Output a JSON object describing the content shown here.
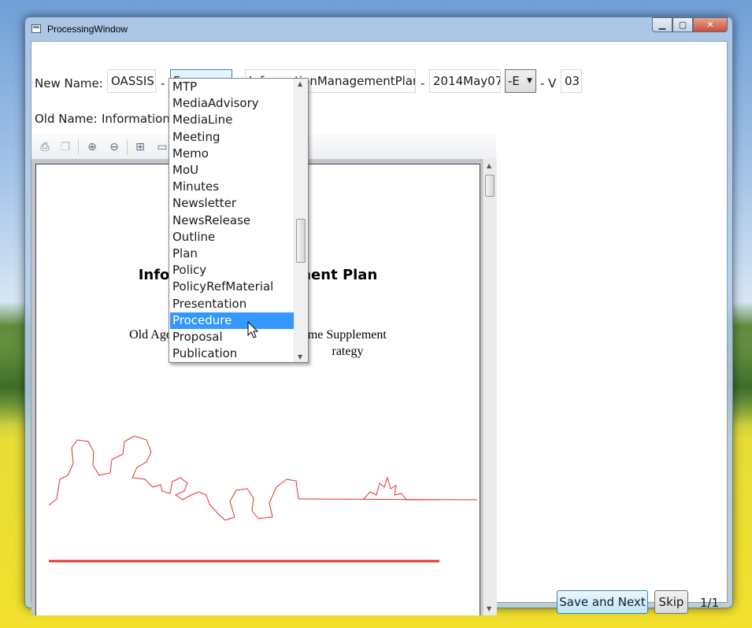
{
  "window": {
    "title": "ProcessingWindow",
    "minimize": "▁",
    "maximize": "▢",
    "close": "✕"
  },
  "new_name": {
    "label": "New Name:",
    "prefix": "OASSIS",
    "sep1": "-",
    "type_value": "Form",
    "sep2": "-",
    "title_value": "InformationManagementPlan",
    "sep3": "-",
    "date_value": "2014May07",
    "lang_value": "-E",
    "sep4": "- V",
    "version_value": "03"
  },
  "old_name": {
    "label": "Old Name:",
    "value": "Information"
  },
  "type_options": [
    "MTP",
    "MediaAdvisory",
    "MediaLine",
    "Meeting",
    "Memo",
    "MoU",
    "Minutes",
    "Newsletter",
    "NewsRelease",
    "Outline",
    "Plan",
    "Policy",
    "PolicyRefMaterial",
    "Presentation",
    "Procedure",
    "Proposal",
    "Publication"
  ],
  "highlighted_option": "Procedure",
  "document": {
    "title_left": "Infor",
    "title_right": "ment Plan",
    "line1_left": "Old Age S",
    "line1_right": "ome Supplement",
    "line2_right": "rategy"
  },
  "buttons": {
    "save_next": "Save and Next",
    "skip": "Skip"
  },
  "page_counter": "1/1",
  "colors": {
    "accent_red": "#e0322d",
    "selection": "#3399ff"
  },
  "toolbar_icons": [
    "print-icon",
    "copy-icon",
    "zoom-in-icon",
    "zoom-out-icon",
    "actual-size-icon",
    "page-width-icon"
  ]
}
